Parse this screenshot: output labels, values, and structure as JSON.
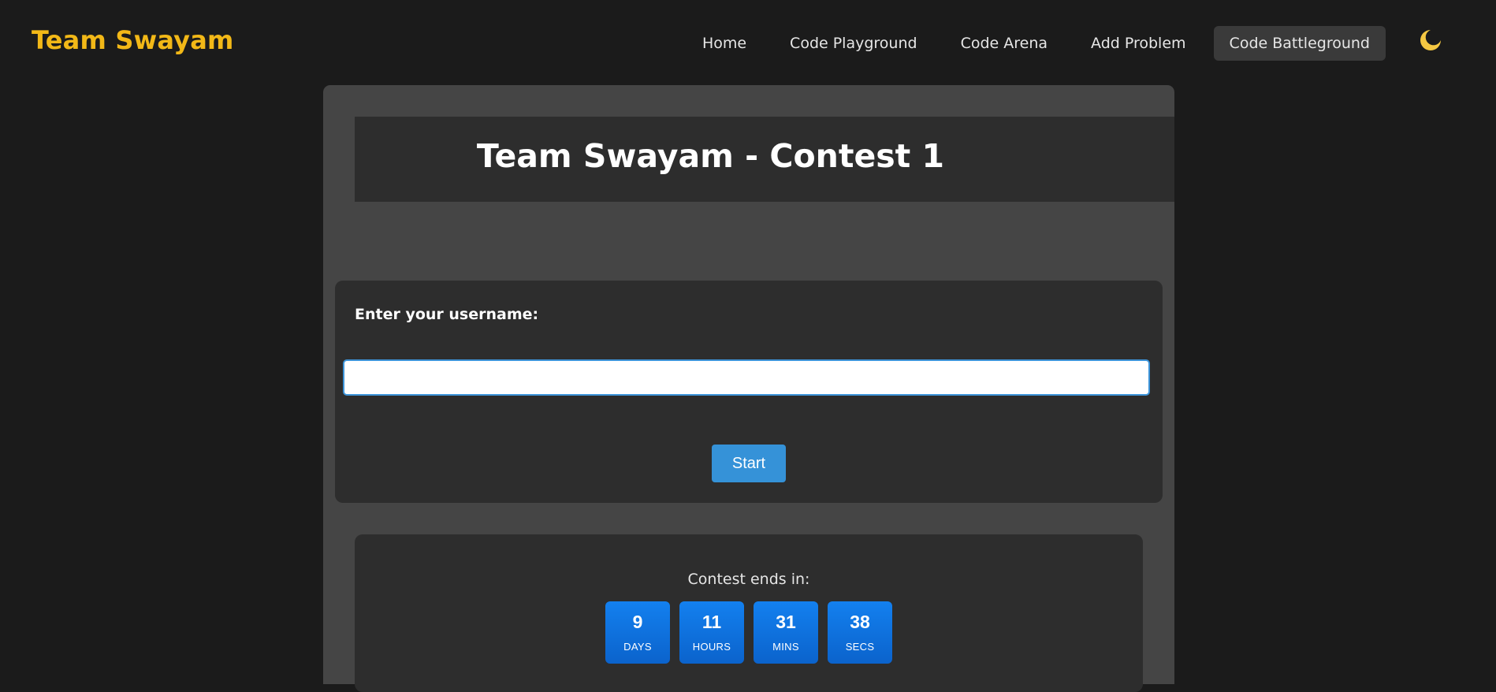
{
  "brand": {
    "name": "Team Swayam",
    "color": "#f2b817"
  },
  "nav": {
    "items": [
      {
        "label": "Home"
      },
      {
        "label": "Code Playground"
      },
      {
        "label": "Code Arena"
      },
      {
        "label": "Add Problem"
      },
      {
        "label": "Code Battleground",
        "active": true
      }
    ],
    "theme_icon": "moon-icon"
  },
  "contest": {
    "title": "Team Swayam - Contest 1"
  },
  "form": {
    "label": "Enter your username:",
    "value": "",
    "placeholder": "",
    "start_label": "Start"
  },
  "timer": {
    "label": "Contest ends in:",
    "days": {
      "value": "9",
      "unit": "DAYS"
    },
    "hours": {
      "value": "11",
      "unit": "HOURS"
    },
    "mins": {
      "value": "31",
      "unit": "MINS"
    },
    "secs": {
      "value": "38",
      "unit": "SECS"
    }
  },
  "colors": {
    "background": "#1b1b1b",
    "card": "#454545",
    "panel": "#2d2d2d",
    "accent_blue": "#3592d8",
    "timer_blue": "#1380ef"
  }
}
